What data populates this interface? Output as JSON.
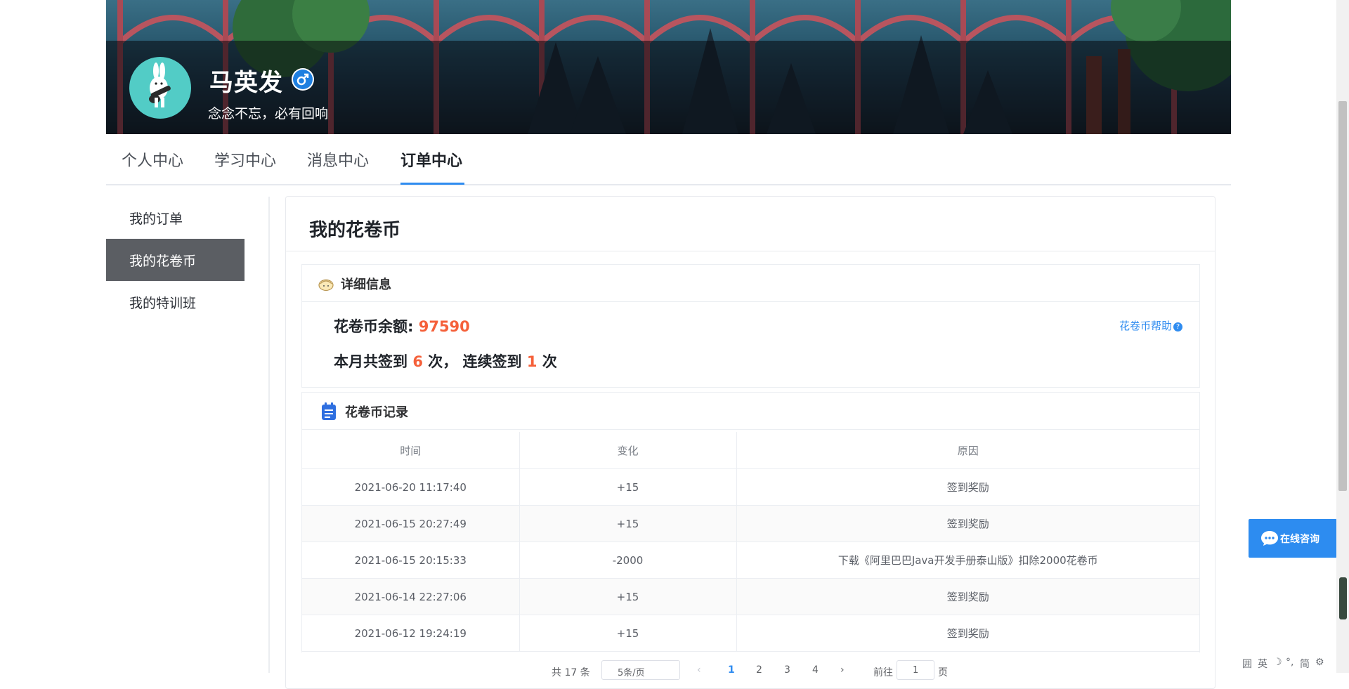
{
  "profile": {
    "name": "马英发",
    "gender_icon": "male-icon",
    "motto": "念念不忘，必有回响"
  },
  "nav": {
    "tabs": [
      {
        "label": "个人中心",
        "active": false
      },
      {
        "label": "学习中心",
        "active": false
      },
      {
        "label": "消息中心",
        "active": false
      },
      {
        "label": "订单中心",
        "active": true
      }
    ]
  },
  "sidebar": {
    "items": [
      {
        "label": "我的订单",
        "active": false
      },
      {
        "label": "我的花卷币",
        "active": true
      },
      {
        "label": "我的特训班",
        "active": false
      }
    ]
  },
  "main": {
    "title": "我的花卷币",
    "detail": {
      "title": "详细信息",
      "balance_label": "花卷币余额:",
      "balance_value": "97590",
      "sign_prefix": "本月共签到",
      "sign_count": "6",
      "sign_mid": "次， 连续签到",
      "sign_streak": "1",
      "sign_suffix": "次",
      "help_label": "花卷币帮助",
      "help_mark": "?"
    },
    "records": {
      "title": "花卷币记录",
      "columns": [
        "时间",
        "变化",
        "原因"
      ],
      "rows": [
        {
          "time": "2021-06-20 11:17:40",
          "change": "+15",
          "reason": "签到奖励"
        },
        {
          "time": "2021-06-15 20:27:49",
          "change": "+15",
          "reason": "签到奖励"
        },
        {
          "time": "2021-06-15 20:15:33",
          "change": "-2000",
          "reason": "下载《阿里巴巴Java开发手册泰山版》扣除2000花卷币"
        },
        {
          "time": "2021-06-14 22:27:06",
          "change": "+15",
          "reason": "签到奖励"
        },
        {
          "time": "2021-06-12 19:24:19",
          "change": "+15",
          "reason": "签到奖励"
        }
      ]
    },
    "pagination": {
      "total": "共 17 条",
      "page_size": "5条/页",
      "pages": [
        "1",
        "2",
        "3",
        "4"
      ],
      "current_page": "1",
      "goto_label": "前往",
      "goto_value": "1",
      "goto_suffix": "页"
    }
  },
  "consult": {
    "label": "在线咨询",
    "icon": "chat-bubble-icon"
  },
  "ime": {
    "items": [
      "囲",
      "英",
      "☽",
      "°,",
      "简",
      "⚙"
    ]
  },
  "colors": {
    "accent": "#2f8cf0",
    "highlight": "#f5603a",
    "sidebar_active": "#5b5e63",
    "avatar_bg": "#52ccc6"
  }
}
